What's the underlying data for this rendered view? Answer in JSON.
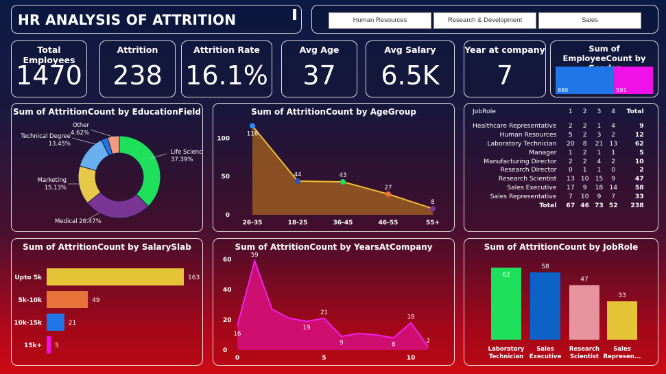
{
  "title": "HR ANALYSIS OF ATTRITION",
  "departments": [
    "Human Resources",
    "Research & Development",
    "Sales"
  ],
  "kpis": [
    {
      "label": "Total Employees",
      "value": "1470"
    },
    {
      "label": "Attrition",
      "value": "238"
    },
    {
      "label": "Attrition Rate",
      "value": "16.1%"
    },
    {
      "label": "Avg Age",
      "value": "37"
    },
    {
      "label": "Avg Salary",
      "value": "6.5K"
    },
    {
      "label": "Year at company",
      "value": "7"
    }
  ],
  "colors": {
    "green": "#1ee05a",
    "purple": "#7b3594",
    "yellow": "#e8c84a",
    "lightblue": "#69b0f0",
    "blue": "#1f76e8",
    "salmon": "#f39a7e",
    "orange": "#e8733a",
    "magenta": "#f010e8",
    "dblue": "#0d62c8",
    "pink": "#e8949e",
    "gold": "#e6c437"
  },
  "chart_data": [
    {
      "id": "gender",
      "type": "bar",
      "title": "Sum of EmployeeCount by Gender",
      "categories": [
        "",
        ""
      ],
      "values": [
        889,
        591
      ]
    },
    {
      "id": "education",
      "type": "pie",
      "title": "Sum of AttritionCount by EducationField",
      "slices": [
        {
          "label": "Life Sciences",
          "pct": "37.39%",
          "value": 37.39
        },
        {
          "label": "Medical",
          "pct": "26.47%",
          "value": 26.47
        },
        {
          "label": "Marketing",
          "pct": "15.13%",
          "value": 15.13
        },
        {
          "label": "Technical Degree",
          "pct": "13.45%",
          "value": 13.45
        },
        {
          "label": "",
          "pct": "",
          "value": 2.52
        },
        {
          "label": "Other",
          "pct": "4.62%",
          "value": 4.62
        }
      ]
    },
    {
      "id": "agegroup",
      "type": "area",
      "title": "Sum of AttritionCount by AgeGroup",
      "categories": [
        "26-35",
        "18-25",
        "36-45",
        "46-55",
        "55+"
      ],
      "values": [
        116,
        44,
        43,
        27,
        8
      ],
      "ylim": [
        0,
        120
      ],
      "yticks": [
        0,
        50,
        100
      ]
    },
    {
      "id": "jobtable",
      "type": "table",
      "columns": [
        "JobRole",
        "1",
        "2",
        "3",
        "4",
        "Total"
      ],
      "rows": [
        [
          "Healthcare Representative",
          "2",
          "2",
          "1",
          "4",
          "9"
        ],
        [
          "Human Resources",
          "5",
          "2",
          "3",
          "2",
          "12"
        ],
        [
          "Laboratory Technician",
          "20",
          "8",
          "21",
          "13",
          "62"
        ],
        [
          "Manager",
          "1",
          "2",
          "1",
          "1",
          "5"
        ],
        [
          "Manufacturing Director",
          "2",
          "2",
          "4",
          "2",
          "10"
        ],
        [
          "Research Director",
          "0",
          "1",
          "1",
          "0",
          "2"
        ],
        [
          "Research Scientist",
          "13",
          "10",
          "15",
          "9",
          "47"
        ],
        [
          "Sales Executive",
          "17",
          "9",
          "18",
          "14",
          "58"
        ],
        [
          "Sales Representative",
          "7",
          "10",
          "9",
          "7",
          "33"
        ]
      ],
      "total": [
        "Total",
        "67",
        "46",
        "73",
        "52",
        "238"
      ]
    },
    {
      "id": "salary",
      "type": "bar",
      "title": "Sum of AttritionCount by SalarySlab",
      "categories": [
        "Upto 5k",
        "5k-10k",
        "10k-15k",
        "15k+"
      ],
      "values": [
        163,
        49,
        21,
        5
      ]
    },
    {
      "id": "years",
      "type": "area",
      "title": "Sum of AttritionCount by YearsAtCompany",
      "x": [
        0,
        1,
        2,
        3,
        4,
        5,
        6,
        7,
        8,
        9,
        10,
        11
      ],
      "values": [
        16,
        59,
        27,
        21,
        19,
        21,
        9,
        11,
        10,
        8,
        18,
        2
      ],
      "labels": [
        "16",
        "59",
        "",
        "",
        "19",
        "21",
        "9",
        "",
        "",
        "8",
        "18",
        "2"
      ],
      "ylim": [
        0,
        60
      ],
      "yticks": [
        0,
        20,
        40,
        60
      ],
      "xticks": [
        0,
        5,
        10
      ]
    },
    {
      "id": "jobrole",
      "type": "bar",
      "title": "Sum of AttritionCount by JobRole",
      "categories": [
        [
          "Laboratory",
          "Technician"
        ],
        [
          "Sales",
          "Executive"
        ],
        [
          "Research",
          "Scientist"
        ],
        [
          "Sales",
          "Represen..."
        ]
      ],
      "values": [
        62,
        58,
        47,
        33
      ]
    }
  ]
}
